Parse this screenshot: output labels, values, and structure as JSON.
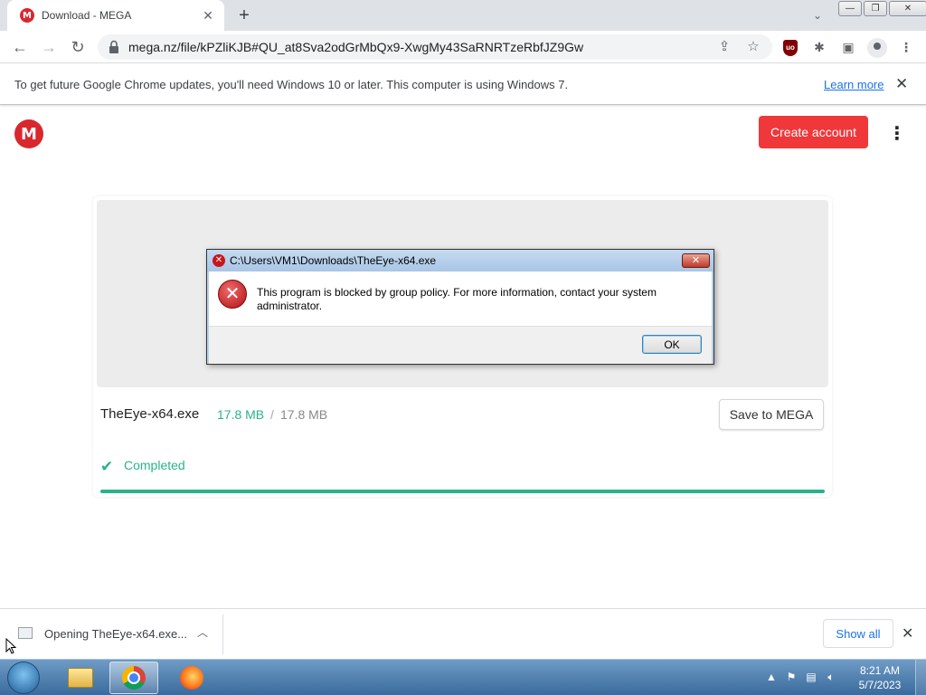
{
  "browser": {
    "tab": {
      "favicon": "M",
      "title": "Download - MEGA"
    },
    "new_tab_label": "+",
    "url": "mega.nz/file/kPZliKJB#QU_at8Sva2odGrMbQx9-XwgMy43SaRNRTzeRbfJZ9Gw",
    "ublock_badge": "uo",
    "window_controls": {
      "minimize": "—",
      "maximize": "❐",
      "close": "✕"
    }
  },
  "infobar": {
    "message": "To get future Google Chrome updates, you'll need Windows 10 or later. This computer is using Windows 7.",
    "link": "Learn more"
  },
  "mega": {
    "logo": "M",
    "create_account": "Create account",
    "file": {
      "name": "TheEye-x64.exe",
      "downloaded": "17.8 MB",
      "separator": "/",
      "total": "17.8 MB",
      "save_label": "Save to MEGA",
      "status": "Completed",
      "progress": 1.0
    }
  },
  "dialog": {
    "title": "C:\\Users\\VM1\\Downloads\\TheEye-x64.exe",
    "message": "This program is blocked by group policy. For more information, contact your system administrator.",
    "ok": "OK"
  },
  "download_shelf": {
    "item": "Opening TheEye-x64.exe...",
    "show_all": "Show all"
  },
  "taskbar": {
    "time": "8:21 AM",
    "date": "5/7/2023"
  },
  "colors": {
    "mega_red": "#f0373a",
    "mega_green": "#28b38a",
    "link_blue": "#1a73e8"
  }
}
